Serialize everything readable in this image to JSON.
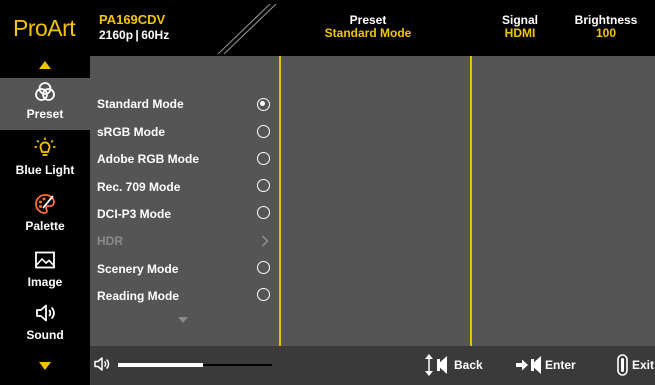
{
  "header": {
    "logo": "ProArt",
    "model": "PA169CDV",
    "resolution": "2160p | 60Hz",
    "columns": [
      {
        "label": "Preset",
        "value": "Standard Mode"
      },
      {
        "label": "Signal",
        "value": "HDMI"
      },
      {
        "label": "Brightness",
        "value": "100"
      }
    ],
    "accent_color": "#f4c400"
  },
  "nav": {
    "items": [
      {
        "label": "Preset",
        "icon": "preset-icon",
        "active": true
      },
      {
        "label": "Blue Light",
        "icon": "blue-light-icon",
        "active": false
      },
      {
        "label": "Palette",
        "icon": "palette-icon",
        "active": false
      },
      {
        "label": "Image",
        "icon": "image-icon",
        "active": false
      },
      {
        "label": "Sound",
        "icon": "sound-icon",
        "active": false
      }
    ]
  },
  "menu": {
    "options": [
      {
        "label": "Standard Mode",
        "control": "radio",
        "selected": true
      },
      {
        "label": "sRGB Mode",
        "control": "radio",
        "selected": false
      },
      {
        "label": "Adobe RGB Mode",
        "control": "radio",
        "selected": false
      },
      {
        "label": "Rec. 709 Mode",
        "control": "radio",
        "selected": false
      },
      {
        "label": "DCI-P3 Mode",
        "control": "radio",
        "selected": false
      },
      {
        "label": "HDR",
        "control": "submenu",
        "disabled": true
      },
      {
        "label": "Scenery Mode",
        "control": "radio",
        "selected": false
      },
      {
        "label": "Reading Mode",
        "control": "radio",
        "selected": false
      }
    ]
  },
  "footer": {
    "volume_level": 0.55,
    "back_label": "Back",
    "enter_label": "Enter",
    "exit_label": "Exit"
  }
}
